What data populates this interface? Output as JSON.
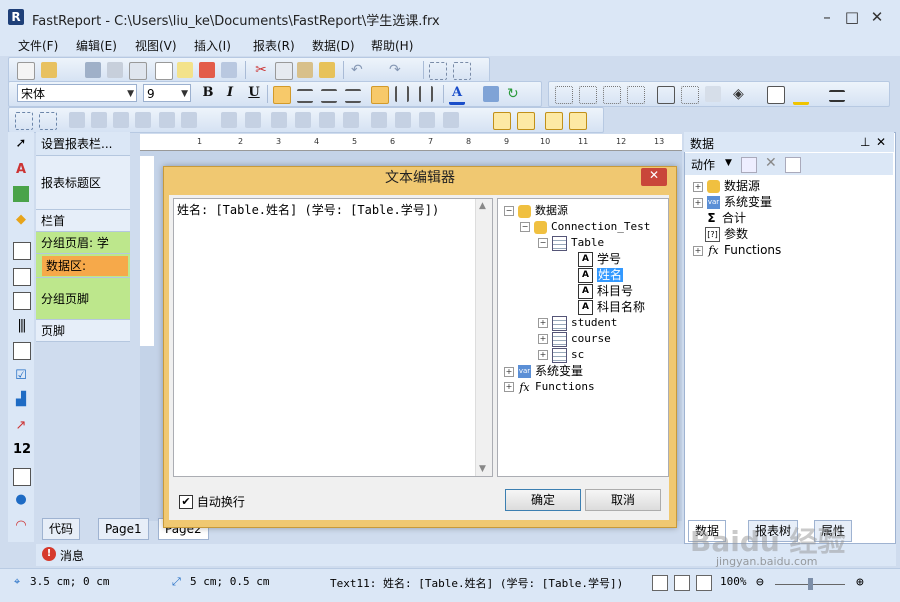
{
  "window": {
    "title": "FastReport - C:\\Users\\liu_ke\\Documents\\FastReport\\学生选课.frx",
    "minimize": "–",
    "maximize": "□",
    "close": "✕"
  },
  "menu": [
    "文件(F)",
    "编辑(E)",
    "视图(V)",
    "插入(I)",
    "报表(R)",
    "数据(D)",
    "帮助(H)"
  ],
  "format_toolbar": {
    "font": "宋体",
    "size": "9",
    "bold": "B",
    "italic": "I",
    "underline": "U"
  },
  "bands": [
    {
      "label": "设置报表栏..."
    },
    {
      "label": "报表标题区"
    },
    {
      "label": "栏首"
    },
    {
      "label": "分组页眉: 学"
    },
    {
      "label": "数据区:"
    },
    {
      "label": "分组页脚"
    },
    {
      "label": "页脚"
    }
  ],
  "ruler": [
    "1",
    "2",
    "3",
    "4",
    "5",
    "6",
    "7",
    "8",
    "9",
    "10",
    "11",
    "12",
    "13"
  ],
  "right_panel": {
    "title": "数据",
    "pin": "⊥",
    "close": "✕",
    "actions_label": "动作",
    "tree": [
      {
        "label": "数据源",
        "icon": "db-icon",
        "expander": "+"
      },
      {
        "label": "系统变量",
        "icon": "var-icon",
        "expander": "+"
      },
      {
        "label": "合计",
        "icon": "sigma-icon",
        "expander": ""
      },
      {
        "label": "参数",
        "icon": "param-icon",
        "expander": ""
      },
      {
        "label": "Functions",
        "icon": "fx-icon",
        "expander": "+"
      }
    ],
    "tabs": [
      "数据",
      "报表树",
      "属性"
    ]
  },
  "dialog": {
    "title": "文本编辑器",
    "close": "✕",
    "expression": "姓名: [Table.姓名] (学号: [Table.学号])",
    "tree": [
      {
        "label": "数据源",
        "level": 0,
        "expander": "−",
        "icon": "db-icon"
      },
      {
        "label": "Connection_Test",
        "level": 1,
        "expander": "−",
        "icon": "db-icon"
      },
      {
        "label": "Table",
        "level": 2,
        "expander": "−",
        "icon": "table-icon"
      },
      {
        "label": "学号",
        "level": 3,
        "expander": "",
        "icon": "text-field-icon"
      },
      {
        "label": "姓名",
        "level": 3,
        "expander": "",
        "icon": "text-field-icon",
        "selected": true
      },
      {
        "label": "科目号",
        "level": 3,
        "expander": "",
        "icon": "text-field-icon"
      },
      {
        "label": "科目名称",
        "level": 3,
        "expander": "",
        "icon": "text-field-icon"
      },
      {
        "label": "student",
        "level": 2,
        "expander": "+",
        "icon": "table-icon"
      },
      {
        "label": "course",
        "level": 2,
        "expander": "+",
        "icon": "table-icon"
      },
      {
        "label": "sc",
        "level": 2,
        "expander": "+",
        "icon": "table-icon"
      },
      {
        "label": "系统变量",
        "level": 0,
        "expander": "+",
        "icon": "var-icon"
      },
      {
        "label": "Functions",
        "level": 0,
        "expander": "+",
        "icon": "fx-icon"
      }
    ],
    "wordwrap_label": "自动换行",
    "wordwrap_checked": true,
    "ok": "确定",
    "cancel": "取消"
  },
  "bottom_tabs": [
    "代码",
    "Page1",
    "Page2"
  ],
  "message_tab": "消息",
  "status": {
    "position": "3.5 cm; 0 cm",
    "size": "5 cm; 0.5 cm",
    "object": "Text11:  姓名: [Table.姓名] (学号: [Table.学号])",
    "zoom": "100%"
  },
  "watermark": {
    "brand": "Baidu 经验",
    "url": "jingyan.baidu.com"
  },
  "colors": {
    "dialog_frame": "#f0c871",
    "selection": "#3399ff",
    "databand": "#f6a94a",
    "groupband": "#a9e06a"
  }
}
